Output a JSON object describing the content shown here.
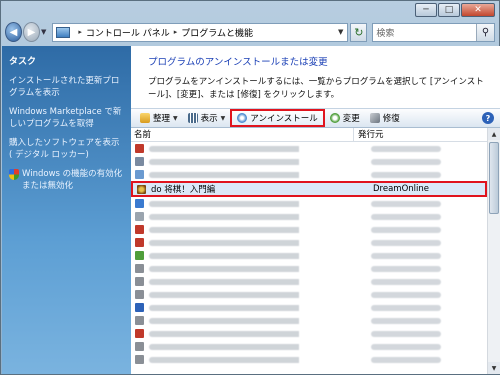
{
  "window": {
    "caption": {
      "minimize": "─",
      "maximize": "□",
      "close": "✕"
    }
  },
  "addressbar": {
    "back_icon": "back-arrow-icon",
    "forward_icon": "forward-arrow-icon",
    "breadcrumb": [
      "コントロール パネル",
      "プログラムと機能"
    ],
    "search_placeholder": "検索"
  },
  "sidebar": {
    "heading": "タスク",
    "links": [
      "インストールされた更新プログラムを表示",
      "Windows Marketplace で新しいプログラムを取得",
      "購入したソフトウェアを表示 ( デジタル ロッカー)",
      "Windows の機能の有効化または無効化"
    ]
  },
  "main": {
    "title": "プログラムのアンインストールまたは変更",
    "description": "プログラムをアンインストールするには、一覧からプログラムを選択して [アンインストール]、[変更]、または [修復] をクリックします。"
  },
  "toolbar": {
    "organize": "整理",
    "view": "表示",
    "uninstall": "アンインストール",
    "change": "変更",
    "repair": "修復",
    "help": "?"
  },
  "list": {
    "columns": {
      "name": "名前",
      "publisher": "発行元"
    },
    "selected": {
      "name": "do 将棋！入門編",
      "publisher": "DreamOnline"
    },
    "icon_colors_before": [
      "#c0392b",
      "#7a8aa0",
      "#6a9ad0"
    ],
    "icon_colors_after": [
      "#3a7ad0",
      "#9aa4ae",
      "#c0392b",
      "#c0392b",
      "#4f9e3a",
      "#8a8f96",
      "#8a8f96",
      "#8a8f96",
      "#2d62b8",
      "#8a8f96",
      "#c0392b",
      "#8a8f96",
      "#8a8f96"
    ]
  }
}
